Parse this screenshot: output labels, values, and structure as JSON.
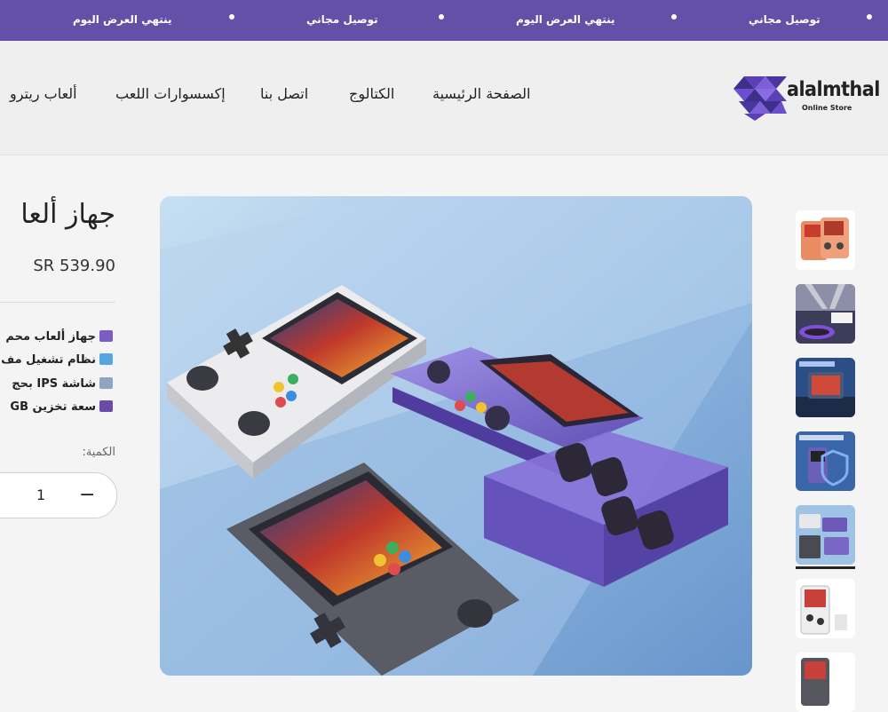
{
  "announcement": {
    "items": [
      "توصيل مجاني",
      "ينتهي العرض اليوم",
      "توصيل مجاني",
      "ينتهي العرض اليوم"
    ]
  },
  "header": {
    "logo_text": "alalmthal",
    "logo_sub": "Online Store",
    "nav": [
      "الصفحة الرئيسية",
      "الكتالوج",
      "اتصل بنا",
      "إكسسوارات اللعب",
      "ألعاب ريترو"
    ]
  },
  "product": {
    "title": "جهاز ألعا",
    "price": "SR 539.90",
    "features": [
      {
        "icon": "gamepad-icon",
        "text": "جهاز ألعاب محم"
      },
      {
        "icon": "computer-icon",
        "text": "نظام تشغيل مف"
      },
      {
        "icon": "tv-icon",
        "text": "شاشة IPS بحج"
      },
      {
        "icon": "floppy-disk-icon",
        "text": "سعة تخزين GB"
      }
    ],
    "quantity_label": "الكمية:",
    "quantity_value": "1",
    "minus_symbol": "−"
  },
  "colors": {
    "announcement_bg": "#6450a6",
    "logo_purple": "#5a3fb5"
  }
}
